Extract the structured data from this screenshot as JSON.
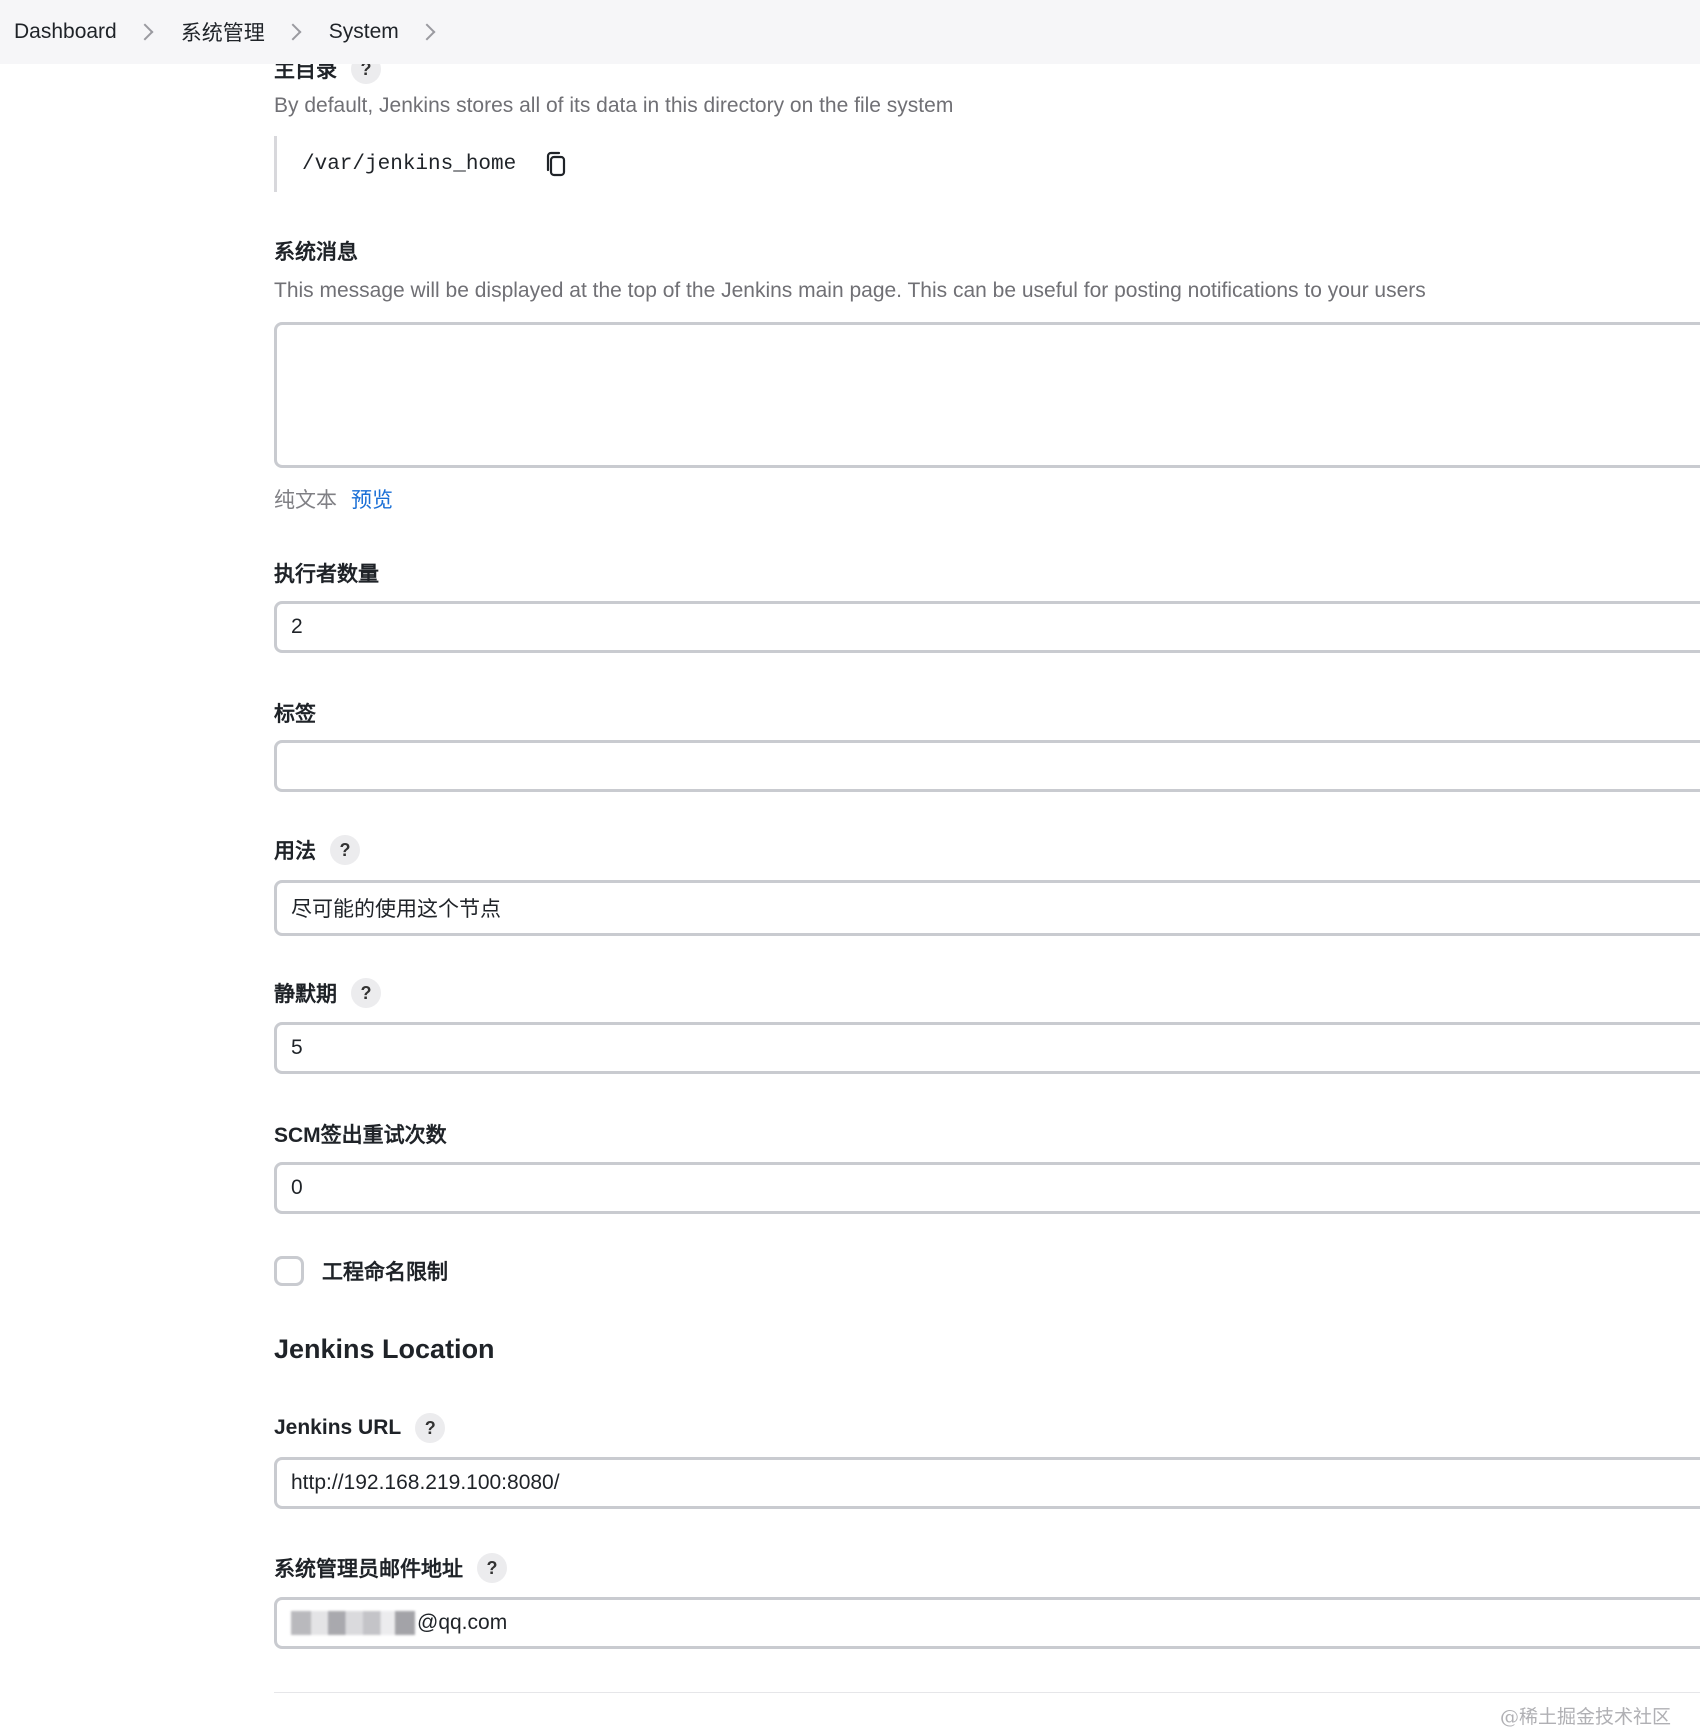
{
  "breadcrumb": {
    "items": [
      "Dashboard",
      "系统管理",
      "System"
    ]
  },
  "home_dir": {
    "label": "主目录",
    "description": "By default, Jenkins stores all of its data in this directory on the file system",
    "path": "/var/jenkins_home",
    "copy_icon": "copy-icon"
  },
  "system_message": {
    "label": "系统消息",
    "description": "This message will be displayed at the top of the Jenkins main page. This can be useful for posting notifications to your users",
    "value": "",
    "plain_text_label": "纯文本",
    "preview_label": "预览"
  },
  "executors": {
    "label": "执行者数量",
    "value": "2"
  },
  "labels": {
    "label": "标签",
    "value": ""
  },
  "usage": {
    "label": "用法",
    "value": "尽可能的使用这个节点"
  },
  "quiet_period": {
    "label": "静默期",
    "value": "5"
  },
  "scm_retry": {
    "label": "SCM签出重试次数",
    "value": "0"
  },
  "project_naming": {
    "label": "工程命名限制",
    "checked": false
  },
  "jenkins_location": {
    "title": "Jenkins Location",
    "url_label": "Jenkins URL",
    "url_value": "http://192.168.219.100:8080/",
    "email_label": "系统管理员邮件地址",
    "email_suffix": "@qq.com"
  },
  "help_symbol": "?",
  "watermark": "@稀土掘金技术社区",
  "colors": {
    "link": "#1a6fd6",
    "border": "#c9cbd0",
    "muted_text": "#707075"
  }
}
